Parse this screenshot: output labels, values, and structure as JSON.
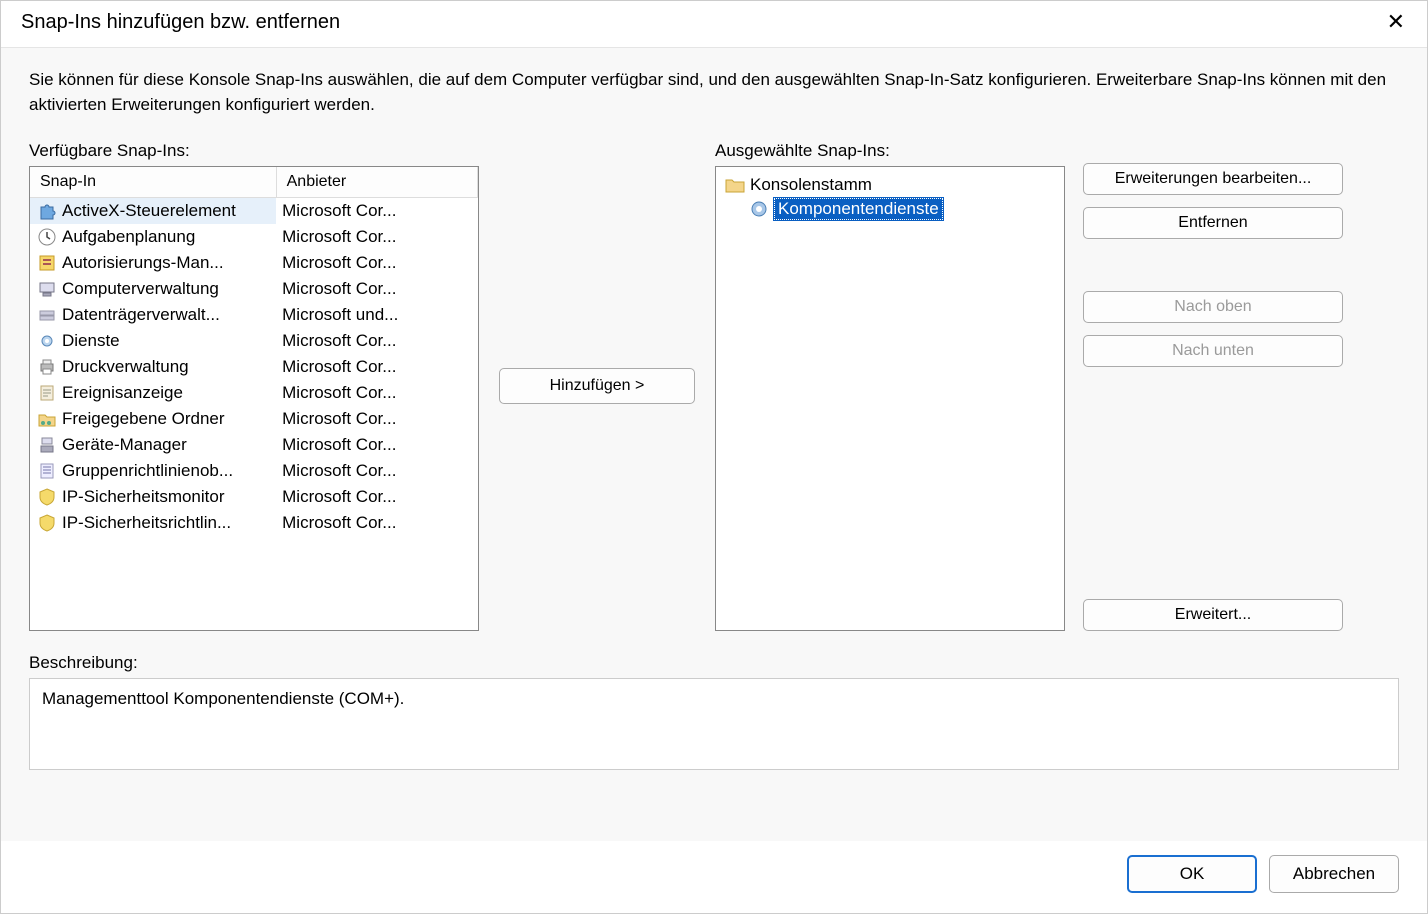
{
  "titlebar": {
    "title": "Snap-Ins hinzufügen bzw. entfernen"
  },
  "intro": "Sie können für diese Konsole Snap-Ins auswählen, die auf dem Computer verfügbar sind, und den ausgewählten Snap-In-Satz konfigurieren. Erweiterbare Snap-Ins können mit den aktivierten Erweiterungen konfiguriert werden.",
  "available_label": "Verfügbare Snap-Ins:",
  "selected_label": "Ausgewählte Snap-Ins:",
  "columns": {
    "snapin": "Snap-In",
    "vendor": "Anbieter"
  },
  "available": [
    {
      "name": "ActiveX-Steuerelement",
      "vendor": "Microsoft Cor...",
      "icon": "puzzle",
      "selected": true
    },
    {
      "name": "Aufgabenplanung",
      "vendor": "Microsoft Cor...",
      "icon": "clock"
    },
    {
      "name": "Autorisierungs-Man...",
      "vendor": "Microsoft Cor...",
      "icon": "authz"
    },
    {
      "name": "Computerverwaltung",
      "vendor": "Microsoft Cor...",
      "icon": "computer"
    },
    {
      "name": "Datenträgerverwalt...",
      "vendor": "Microsoft und...",
      "icon": "disk"
    },
    {
      "name": "Dienste",
      "vendor": "Microsoft Cor...",
      "icon": "gear"
    },
    {
      "name": "Druckverwaltung",
      "vendor": "Microsoft Cor...",
      "icon": "printer"
    },
    {
      "name": "Ereignisanzeige",
      "vendor": "Microsoft Cor...",
      "icon": "event"
    },
    {
      "name": "Freigegebene Ordner",
      "vendor": "Microsoft Cor...",
      "icon": "shared"
    },
    {
      "name": "Geräte-Manager",
      "vendor": "Microsoft Cor...",
      "icon": "device"
    },
    {
      "name": "Gruppenrichtlinienob...",
      "vendor": "Microsoft Cor...",
      "icon": "gpo"
    },
    {
      "name": "IP-Sicherheitsmonitor",
      "vendor": "Microsoft Cor...",
      "icon": "ipsec"
    },
    {
      "name": "IP-Sicherheitsrichtlin...",
      "vendor": "Microsoft Cor...",
      "icon": "ipsec"
    }
  ],
  "selected_tree": {
    "root": "Konsolenstamm",
    "child": "Komponentendienste"
  },
  "buttons": {
    "add": "Hinzufügen >",
    "edit_ext": "Erweiterungen bearbeiten...",
    "remove": "Entfernen",
    "move_up": "Nach oben",
    "move_down": "Nach unten",
    "advanced": "Erweitert...",
    "ok": "OK",
    "cancel": "Abbrechen"
  },
  "description_label": "Beschreibung:",
  "description_text": "Managementtool Komponentendienste (COM+)."
}
